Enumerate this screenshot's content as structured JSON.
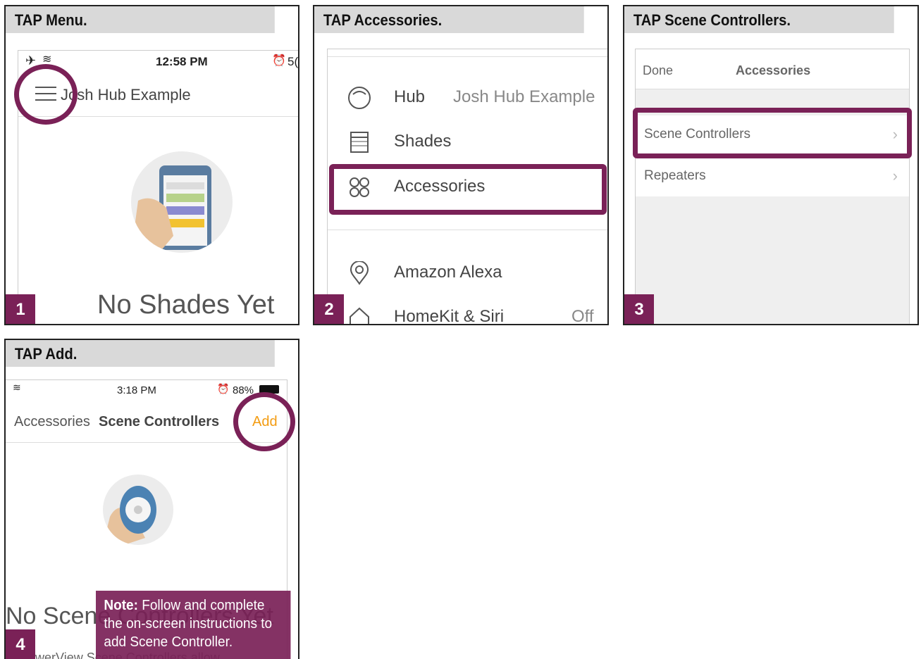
{
  "panel1": {
    "title": "TAP Menu.",
    "step": "1",
    "status_time": "12:58 PM",
    "status_right": "5(",
    "hub_name": "Josh Hub Example",
    "empty_text": "No Shades Yet"
  },
  "panel2": {
    "title": "TAP Accessories.",
    "step": "2",
    "items": [
      {
        "label": "Hub",
        "value": "Josh Hub Example",
        "icon": "hub-circle-icon"
      },
      {
        "label": "Shades",
        "value": "",
        "icon": "shade-icon"
      },
      {
        "label": "Accessories",
        "value": "",
        "icon": "four-circles-icon"
      },
      {
        "label": "Amazon Alexa",
        "value": "",
        "icon": "location-pin-icon"
      },
      {
        "label": "HomeKit & Siri",
        "value": "Off",
        "icon": "home-icon"
      }
    ]
  },
  "panel3": {
    "title": "TAP Scene Controllers.",
    "step": "3",
    "done_label": "Done",
    "nav_title": "Accessories",
    "items": [
      {
        "label": "Scene Controllers"
      },
      {
        "label": "Repeaters"
      }
    ]
  },
  "panel4": {
    "title": "TAP Add.",
    "step": "4",
    "status_time": "3:18 PM",
    "battery_text": "88%",
    "back_label": "Accessories",
    "nav_title": "Scene Controllers",
    "add_label": "Add",
    "empty_text": "No Scene Controllers Yet",
    "sub_text": "PowerView Scene Controllers allow",
    "note_label": "Note:",
    "note_text": "Follow and complete the on-screen instructions to add Scene Controller."
  },
  "colors": {
    "accent": "#7a2157",
    "add_orange": "#f39c12",
    "title_bar": "#d9d9d9"
  }
}
